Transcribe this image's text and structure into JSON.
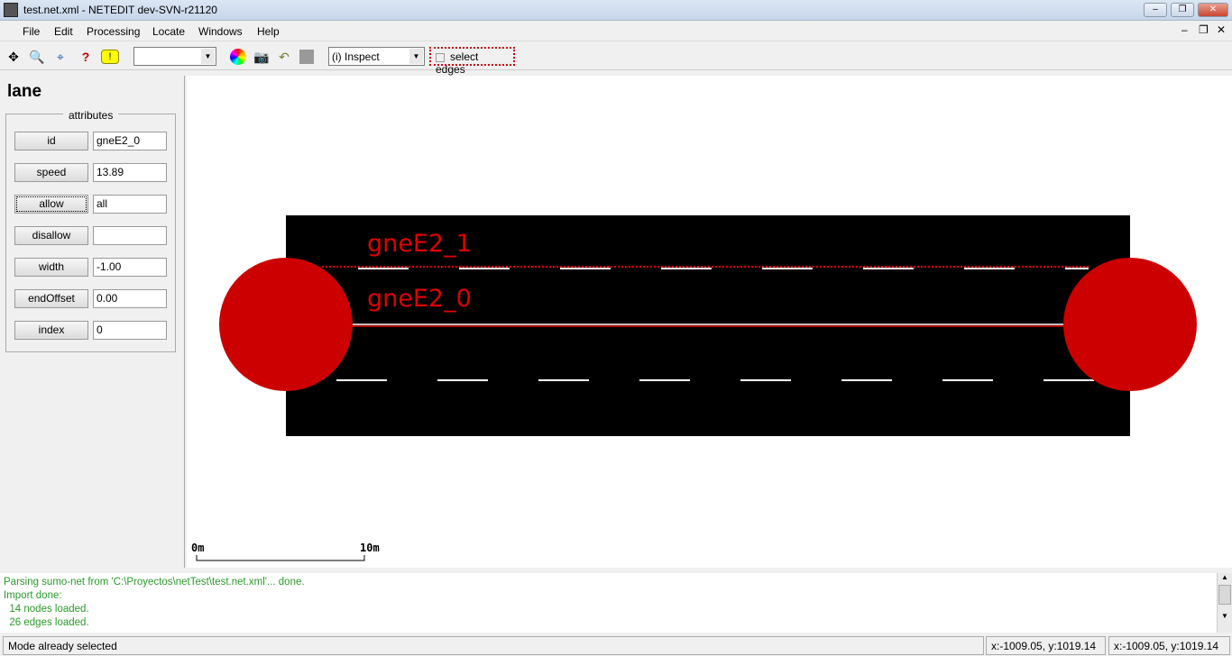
{
  "window": {
    "title": "test.net.xml - NETEDIT dev-SVN-r21120",
    "minimize": "‒",
    "restore": "❐",
    "close": "✕"
  },
  "menu": [
    {
      "label": "File"
    },
    {
      "label": "Edit"
    },
    {
      "label": "Processing"
    },
    {
      "label": "Locate"
    },
    {
      "label": "Windows"
    },
    {
      "label": "Help"
    }
  ],
  "toolbar": {
    "mode_value": "(i) Inspect",
    "color_combo_value": "",
    "select_edges_label": "select edges",
    "select_edges_checked": false
  },
  "panel": {
    "title": "lane",
    "group": "attributes",
    "attributes": [
      {
        "name": "id",
        "value": "gneE2_0"
      },
      {
        "name": "speed",
        "value": "13.89"
      },
      {
        "name": "allow",
        "value": "all"
      },
      {
        "name": "disallow",
        "value": ""
      },
      {
        "name": "width",
        "value": "-1.00"
      },
      {
        "name": "endOffset",
        "value": "0.00"
      },
      {
        "name": "index",
        "value": "0"
      }
    ]
  },
  "canvas": {
    "lanes": [
      "gneE2_1",
      "gneE2_0"
    ],
    "scale": {
      "start": "0m",
      "end": "10m"
    },
    "colors": {
      "road": "#000000",
      "junction": "#cc0000",
      "label": "#dd0000"
    }
  },
  "log": [
    "Parsing sumo-net from 'C:\\Proyectos\\netTest\\test.net.xml'... done.",
    "Import done:",
    "  14 nodes loaded.",
    "  26 edges loaded."
  ],
  "status": {
    "message": "Mode already selected",
    "coords1": "x:-1009.05, y:1019.14",
    "coords2": "x:-1009.05, y:1019.14"
  }
}
